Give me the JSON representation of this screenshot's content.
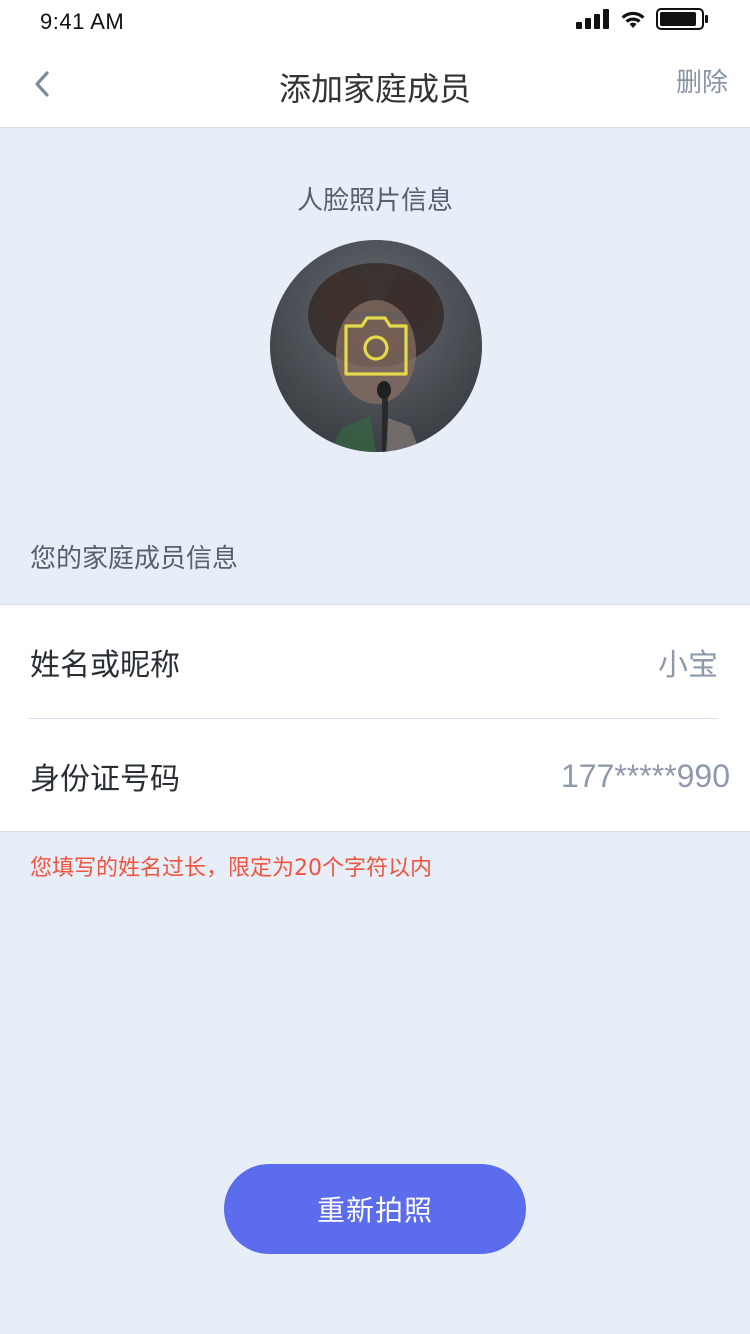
{
  "status_bar": {
    "time": "9:41 AM",
    "signal_icon": "cellular-signal-icon",
    "wifi_icon": "wifi-icon",
    "battery_icon": "battery-icon"
  },
  "nav": {
    "back_icon": "chevron-left-icon",
    "title": "添加家庭成员",
    "action_label": "删除"
  },
  "face": {
    "label": "人脸照片信息",
    "camera_icon": "camera-icon",
    "camera_color": "#e3d94a"
  },
  "member_info": {
    "caption": "您的家庭成员信息",
    "name_label": "姓名或昵称",
    "name_value": "小宝",
    "id_label": "身份证号码",
    "id_value": "177*****990"
  },
  "error": {
    "message": "您填写的姓名过长，限定为20个字符以内",
    "color": "#f0533e"
  },
  "actions": {
    "retake_label": "重新拍照",
    "accent_color": "#5b6cec"
  }
}
